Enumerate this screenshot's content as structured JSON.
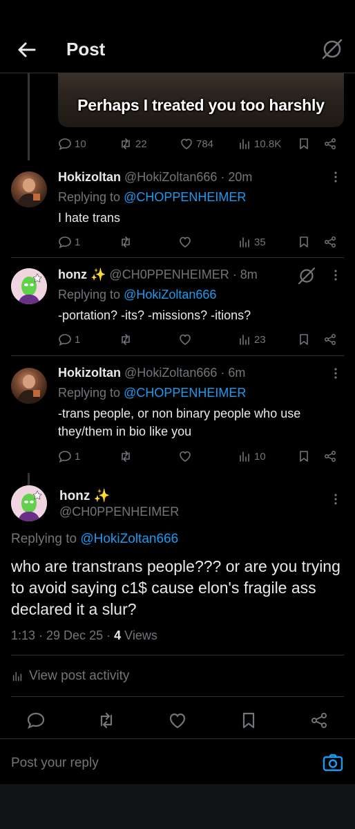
{
  "header": {
    "title": "Post",
    "back_icon": "arrow-left-icon",
    "grok_icon": "grok-icon"
  },
  "top_tweet": {
    "caption": "Perhaps I treated you too harshly",
    "replies": "10",
    "reposts": "22",
    "likes": "784",
    "views": "10.8K"
  },
  "replies": [
    {
      "name": "Hokizoltan",
      "handle": "@HokiZoltan666",
      "time": "· 20m",
      "replying_label": "Replying to",
      "replying_to": "@CHOPPENHEIMER",
      "text": "I hate trans",
      "replies": "1",
      "views": "35"
    },
    {
      "name": "honz ✨",
      "handle": "@CH0PPENHEIMER",
      "time": "· 8m",
      "replying_label": "Replying to",
      "replying_to": "@HokiZoltan666",
      "text": "-portation? -its? -missions? -itions?",
      "replies": "1",
      "views": "23"
    },
    {
      "name": "Hokizoltan",
      "handle": "@HokiZoltan666",
      "time": "· 6m",
      "replying_label": "Replying to",
      "replying_to": "@CHOPPENHEIMER",
      "text": "-trans people, or non binary people who use they/them in bio like you",
      "replies": "1",
      "views": "10"
    }
  ],
  "main": {
    "name": "honz ✨",
    "handle": "@CH0PPENHEIMER",
    "replying_label": "Replying to",
    "replying_to": "@HokiZoltan666",
    "text": "who are transtrans people??? or are you trying to avoid saying c1$ cause elon's fragile ass declared it a slur?",
    "time": "1:13 · 29 Dec 25 ·",
    "views_count": "4",
    "views_label": "Views",
    "activity": "View post activity"
  },
  "composer": {
    "placeholder": "Post your reply"
  },
  "colors": {
    "accent": "#1d9bf0",
    "muted": "#71767b",
    "text": "#e7e9ea",
    "bg": "#000000"
  }
}
